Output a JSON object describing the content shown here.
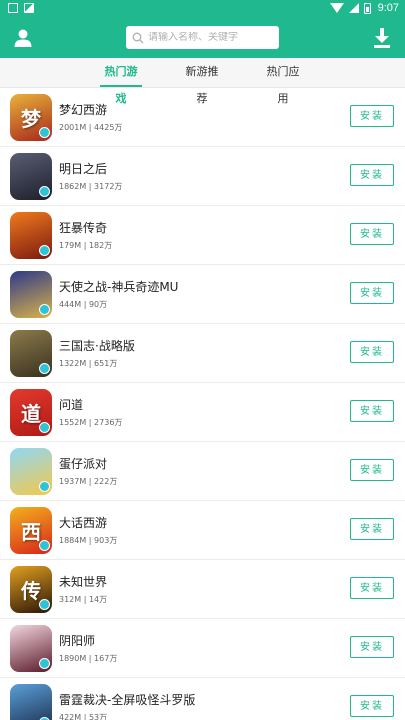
{
  "status_bar": {
    "time": "9:07"
  },
  "header": {
    "search_placeholder": "请输入名称、关键字",
    "icons": {
      "left": "user-icon",
      "right": "download-icon",
      "search": "search-icon"
    }
  },
  "tabs": [
    {
      "label": "热门游戏",
      "active": true
    },
    {
      "label": "新游推荐",
      "active": false
    },
    {
      "label": "热门应用",
      "active": false
    }
  ],
  "install_label": "安装",
  "apps": [
    {
      "name": "梦幻西游",
      "meta": "2001M | 4425万",
      "icon_colors": [
        "#e8b23a",
        "#a8281c"
      ],
      "glyph": "梦"
    },
    {
      "name": "明日之后",
      "meta": "1862M | 3172万",
      "icon_colors": [
        "#5a5e73",
        "#1d1f2b"
      ],
      "glyph": ""
    },
    {
      "name": "狂暴传奇",
      "meta": "179M | 182万",
      "icon_colors": [
        "#f07a1e",
        "#7a1a10"
      ],
      "glyph": ""
    },
    {
      "name": "天使之战-神兵奇迹MU",
      "meta": "444M | 90万",
      "icon_colors": [
        "#2d3a8a",
        "#d9b24a"
      ],
      "glyph": ""
    },
    {
      "name": "三国志·战略版",
      "meta": "1322M | 651万",
      "icon_colors": [
        "#8b7a4a",
        "#3a3220"
      ],
      "glyph": ""
    },
    {
      "name": "问道",
      "meta": "1552M | 2736万",
      "icon_colors": [
        "#e23a2e",
        "#b01a14"
      ],
      "glyph": "道"
    },
    {
      "name": "蛋仔派对",
      "meta": "1937M | 222万",
      "icon_colors": [
        "#8fd8f5",
        "#f4c84a"
      ],
      "glyph": ""
    },
    {
      "name": "大话西游",
      "meta": "1884M | 903万",
      "icon_colors": [
        "#f2b21e",
        "#d8241a"
      ],
      "glyph": "西"
    },
    {
      "name": "未知世界",
      "meta": "312M | 14万",
      "icon_colors": [
        "#e2a020",
        "#2a1608"
      ],
      "glyph": "传"
    },
    {
      "name": "阴阳师",
      "meta": "1890M | 167万",
      "icon_colors": [
        "#f3d7e0",
        "#5a1a2a"
      ],
      "glyph": ""
    },
    {
      "name": "雷霆裁决-全屏吸怪斗罗版",
      "meta": "422M | 53万",
      "icon_colors": [
        "#5aa0d8",
        "#1a2a4a"
      ],
      "glyph": ""
    }
  ]
}
